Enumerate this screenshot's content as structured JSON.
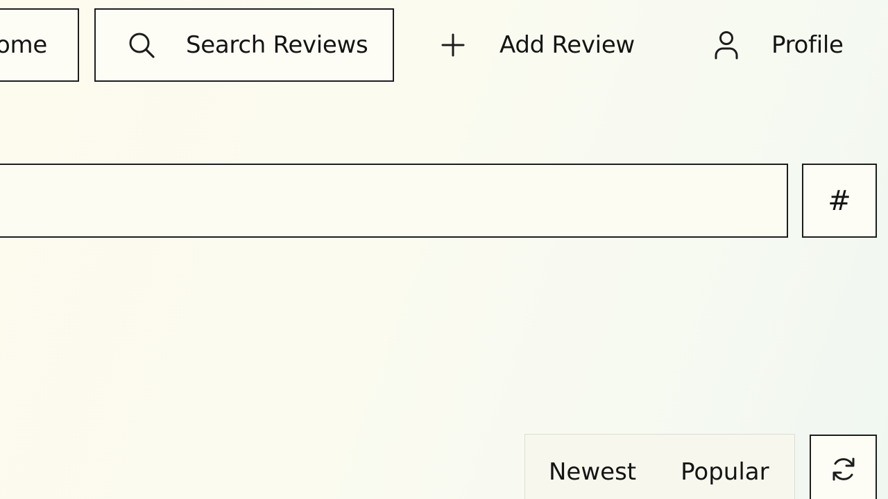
{
  "nav": {
    "home_label": "Home",
    "search_label": "Search Reviews",
    "add_label": "Add Review",
    "profile_label": "Profile"
  },
  "search_row": {
    "input_value": "",
    "hashtag_label": "#"
  },
  "sort": {
    "newest_label": "Newest",
    "popular_label": "Popular"
  },
  "icons": {
    "search": "search-icon",
    "add": "plus-icon",
    "profile": "user-icon",
    "refresh": "refresh-icon"
  },
  "colors": {
    "ink": "#1c1c1c",
    "background": "#fcfbf0"
  }
}
